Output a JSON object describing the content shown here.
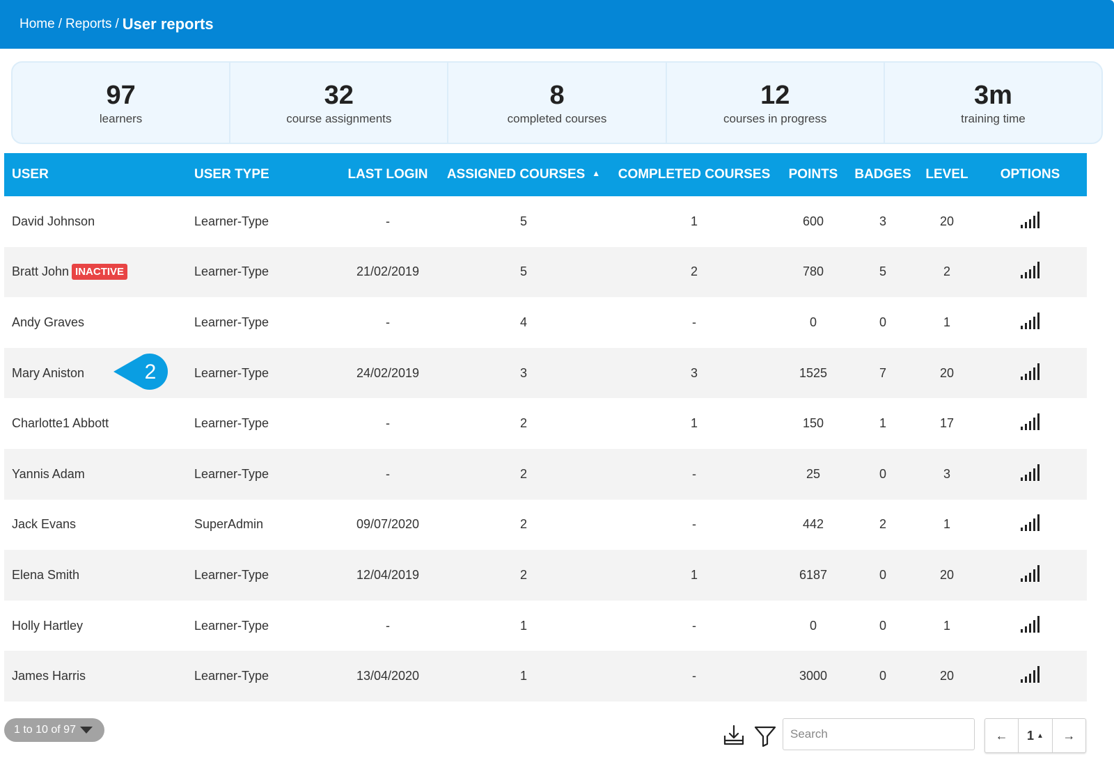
{
  "breadcrumb": {
    "home": "Home",
    "sep": "/",
    "reports": "Reports",
    "current": "User reports"
  },
  "stats": [
    {
      "value": "97",
      "label": "learners"
    },
    {
      "value": "32",
      "label": "course assignments"
    },
    {
      "value": "8",
      "label": "completed courses"
    },
    {
      "value": "12",
      "label": "courses in progress"
    },
    {
      "value": "3m",
      "label": "training time"
    }
  ],
  "table": {
    "columns": {
      "user": "USER",
      "user_type": "USER TYPE",
      "last_login": "LAST LOGIN",
      "assigned": "ASSIGNED COURSES",
      "completed": "COMPLETED COURSES",
      "points": "POINTS",
      "badges": "BADGES",
      "level": "LEVEL",
      "options": "OPTIONS"
    },
    "sort_indicator": "▲",
    "inactive_label": "INACTIVE",
    "rows": [
      {
        "user": "David Johnson",
        "type": "Learner-Type",
        "last_login": "-",
        "assigned": "5",
        "completed": "1",
        "points": "600",
        "badges": "3",
        "level": "20"
      },
      {
        "user": "Bratt John",
        "type": "Learner-Type",
        "last_login": "21/02/2019",
        "assigned": "5",
        "completed": "2",
        "points": "780",
        "badges": "5",
        "level": "2"
      },
      {
        "user": "Andy Graves",
        "type": "Learner-Type",
        "last_login": "-",
        "assigned": "4",
        "completed": "-",
        "points": "0",
        "badges": "0",
        "level": "1"
      },
      {
        "user": "Mary Aniston",
        "type": "Learner-Type",
        "last_login": "24/02/2019",
        "assigned": "3",
        "completed": "3",
        "points": "1525",
        "badges": "7",
        "level": "20"
      },
      {
        "user": "Charlotte1 Abbott",
        "type": "Learner-Type",
        "last_login": "-",
        "assigned": "2",
        "completed": "1",
        "points": "150",
        "badges": "1",
        "level": "17"
      },
      {
        "user": "Yannis Adam",
        "type": "Learner-Type",
        "last_login": "-",
        "assigned": "2",
        "completed": "-",
        "points": "25",
        "badges": "0",
        "level": "3"
      },
      {
        "user": "Jack Evans",
        "type": "SuperAdmin",
        "last_login": "09/07/2020",
        "assigned": "2",
        "completed": "-",
        "points": "442",
        "badges": "2",
        "level": "1"
      },
      {
        "user": "Elena Smith",
        "type": "Learner-Type",
        "last_login": "12/04/2019",
        "assigned": "2",
        "completed": "1",
        "points": "6187",
        "badges": "0",
        "level": "20"
      },
      {
        "user": "Holly Hartley",
        "type": "Learner-Type",
        "last_login": "-",
        "assigned": "1",
        "completed": "-",
        "points": "0",
        "badges": "0",
        "level": "1"
      },
      {
        "user": "James Harris",
        "type": "Learner-Type",
        "last_login": "13/04/2020",
        "assigned": "1",
        "completed": "-",
        "points": "3000",
        "badges": "0",
        "level": "20"
      }
    ]
  },
  "callout": {
    "number": "2",
    "color": "#0a9ee2"
  },
  "footer": {
    "count_label": "1 to 10 of 97",
    "search_placeholder": "Search",
    "prev": "←",
    "page": "1",
    "page_caret": "▲",
    "next": "→"
  },
  "icons": {
    "export": "download-tray-icon",
    "filter": "funnel-icon",
    "options": "signal-bars-icon"
  },
  "colors": {
    "header_bar": "#0586d6",
    "table_header": "#0a9ee2",
    "inactive_badge": "#e84444"
  }
}
